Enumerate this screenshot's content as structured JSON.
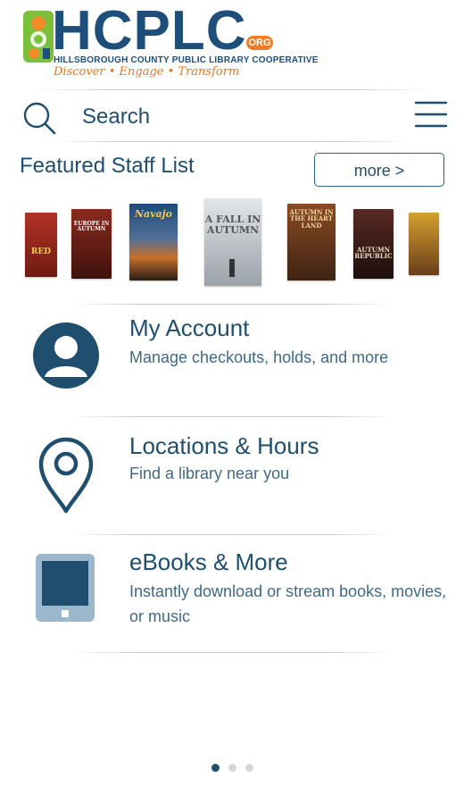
{
  "header": {
    "logo_text": "HCPLC",
    "logo_org": "ORG",
    "logo_subtitle": "HILLSBOROUGH COUNTY PUBLIC LIBRARY COOPERATIVE",
    "tagline": "Discover • Engage • Transform"
  },
  "search": {
    "placeholder": "Search"
  },
  "featured": {
    "title": "Featured Staff List",
    "more_label": "more >",
    "books": [
      {
        "title": "RED",
        "color": "#9b2a1e"
      },
      {
        "title": "EUROPE IN AUTUMN",
        "color": "#6b1e14"
      },
      {
        "title": "Navajo",
        "color": "#1e4a7a"
      },
      {
        "title": "A FALL IN AUTUMN",
        "color": "#b5babf"
      },
      {
        "title": "AUTUMN IN THE HEART LAND",
        "color": "#6e3e1f"
      },
      {
        "title": "AUTUMN REPUBLIC",
        "color": "#3b1f1c"
      },
      {
        "title": "",
        "color": "#c79a2a"
      }
    ]
  },
  "nav": [
    {
      "title": "My Account",
      "description": "Manage checkouts, holds, and more",
      "icon": "account-icon"
    },
    {
      "title": "Locations & Hours",
      "description": "Find a library near you",
      "icon": "location-pin-icon"
    },
    {
      "title": "eBooks & More",
      "description": "Instantly download or stream books, movies, or music",
      "icon": "tablet-icon"
    }
  ],
  "pagination": {
    "pages": 3,
    "active": 1
  },
  "colors": {
    "primary": "#1f4e6e",
    "accent": "#f07c23",
    "logo_green": "#8cc63f"
  }
}
